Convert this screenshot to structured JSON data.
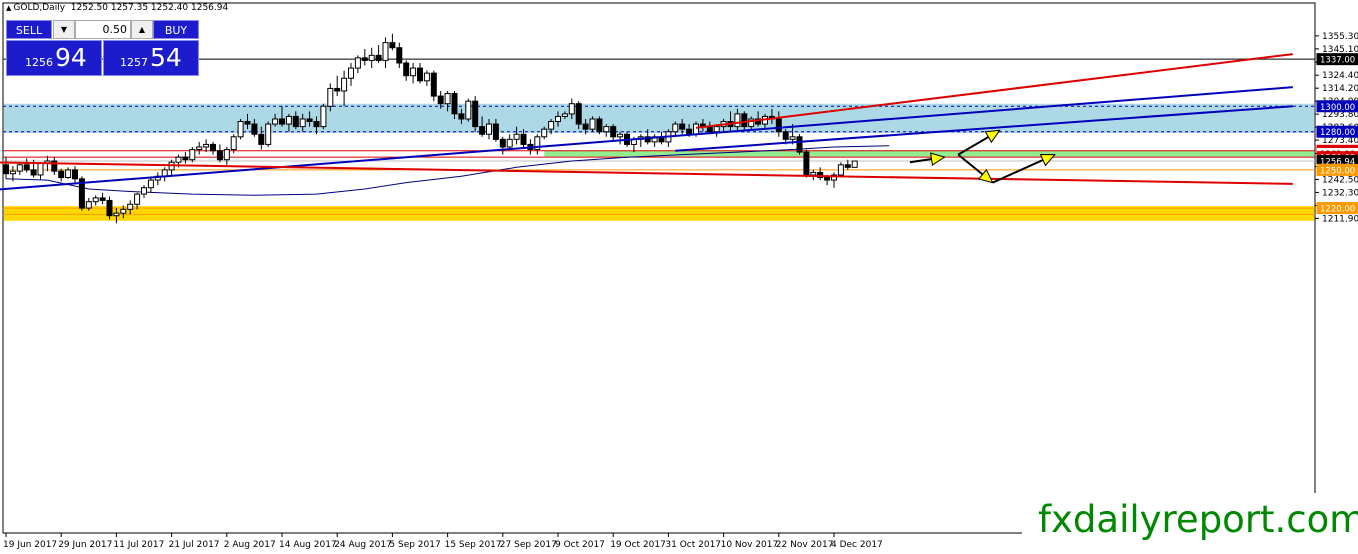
{
  "header": {
    "symbol": "GOLD,Daily",
    "ohlc": "1252.50 1257.35 1252.40 1256.94"
  },
  "trade_panel": {
    "sell_label": "SELL",
    "buy_label": "BUY",
    "lot_value": "0.50",
    "sell_price_small": "1256",
    "sell_price_big": "94",
    "buy_price_small": "1257",
    "buy_price_big": "54"
  },
  "watermark": "fxdailyreport.com",
  "colors": {
    "candle": "#000000",
    "trend_blue": "#0000bb",
    "trend_red": "#dd0000",
    "zone_blue": "#add8e6",
    "zone_green": "#90ee90",
    "zone_yellow": "#ffd700",
    "arrow": "#000000",
    "arrowhead": "#ffff00",
    "moving_average": "#000080",
    "watermark": "#008800"
  },
  "chart_data": {
    "type": "candlestick",
    "title": "GOLD,Daily",
    "ylim": [
      1212.4,
      1361.6
    ],
    "y_ticks": [
      "1355.30",
      "1345.10",
      "1334.60",
      "1324.40",
      "1314.20",
      "1304.00",
      "1293.80",
      "1283.60",
      "1273.40",
      "1262.90",
      "1252.70",
      "1242.50",
      "1232.30",
      "1222.10",
      "1211.90"
    ],
    "x_ticks": [
      "19 Jun 2017",
      "29 Jun 2017",
      "11 Jul 2017",
      "21 Jul 2017",
      "2 Aug 2017",
      "14 Aug 2017",
      "24 Aug 2017",
      "5 Sep 2017",
      "15 Sep 2017",
      "27 Sep 2017",
      "9 Oct 2017",
      "19 Oct 2017",
      "31 Oct 2017",
      "10 Nov 2017",
      "22 Nov 2017",
      "4 Dec 2017"
    ],
    "x_tick_index": [
      0,
      8,
      16,
      24,
      32,
      40,
      48,
      56,
      64,
      72,
      80,
      88,
      96,
      104,
      112,
      120
    ],
    "candles": [
      [
        1254,
        1260,
        1243,
        1247
      ],
      [
        1247,
        1253,
        1241,
        1249
      ],
      [
        1249,
        1256,
        1246,
        1254
      ],
      [
        1254,
        1259,
        1248,
        1250
      ],
      [
        1250,
        1258,
        1244,
        1246
      ],
      [
        1246,
        1256,
        1242,
        1255
      ],
      [
        1255,
        1261,
        1249,
        1257
      ],
      [
        1257,
        1260,
        1246,
        1249
      ],
      [
        1249,
        1251,
        1241,
        1244
      ],
      [
        1244,
        1252,
        1243,
        1250
      ],
      [
        1250,
        1253,
        1240,
        1243
      ],
      [
        1243,
        1245,
        1218,
        1220
      ],
      [
        1220,
        1228,
        1218,
        1225
      ],
      [
        1225,
        1230,
        1222,
        1228
      ],
      [
        1228,
        1232,
        1223,
        1226
      ],
      [
        1226,
        1229,
        1211,
        1214
      ],
      [
        1214,
        1220,
        1208,
        1216
      ],
      [
        1216,
        1222,
        1212,
        1219
      ],
      [
        1219,
        1226,
        1215,
        1223
      ],
      [
        1223,
        1232,
        1219,
        1231
      ],
      [
        1231,
        1238,
        1228,
        1236
      ],
      [
        1236,
        1244,
        1232,
        1242
      ],
      [
        1242,
        1248,
        1238,
        1245
      ],
      [
        1245,
        1252,
        1241,
        1250
      ],
      [
        1250,
        1258,
        1246,
        1256
      ],
      [
        1256,
        1262,
        1252,
        1260
      ],
      [
        1260,
        1264,
        1255,
        1258
      ],
      [
        1258,
        1268,
        1256,
        1266
      ],
      [
        1266,
        1272,
        1262,
        1268
      ],
      [
        1268,
        1274,
        1264,
        1270
      ],
      [
        1270,
        1272,
        1262,
        1265
      ],
      [
        1265,
        1270,
        1256,
        1258
      ],
      [
        1258,
        1268,
        1254,
        1266
      ],
      [
        1266,
        1278,
        1263,
        1276
      ],
      [
        1276,
        1290,
        1274,
        1288
      ],
      [
        1288,
        1294,
        1282,
        1286
      ],
      [
        1286,
        1290,
        1276,
        1278
      ],
      [
        1278,
        1284,
        1266,
        1270
      ],
      [
        1270,
        1288,
        1268,
        1286
      ],
      [
        1286,
        1294,
        1284,
        1290
      ],
      [
        1290,
        1300,
        1284,
        1286
      ],
      [
        1286,
        1294,
        1280,
        1292
      ],
      [
        1292,
        1296,
        1282,
        1284
      ],
      [
        1284,
        1294,
        1280,
        1290
      ],
      [
        1290,
        1296,
        1284,
        1288
      ],
      [
        1288,
        1292,
        1278,
        1284
      ],
      [
        1284,
        1302,
        1282,
        1300
      ],
      [
        1300,
        1318,
        1296,
        1314
      ],
      [
        1314,
        1324,
        1308,
        1312
      ],
      [
        1312,
        1328,
        1300,
        1322
      ],
      [
        1322,
        1334,
        1316,
        1330
      ],
      [
        1330,
        1340,
        1326,
        1338
      ],
      [
        1338,
        1345,
        1332,
        1336
      ],
      [
        1336,
        1346,
        1330,
        1340
      ],
      [
        1340,
        1348,
        1334,
        1336
      ],
      [
        1336,
        1354,
        1330,
        1350
      ],
      [
        1350,
        1357,
        1344,
        1346
      ],
      [
        1346,
        1350,
        1330,
        1334
      ],
      [
        1334,
        1336,
        1320,
        1324
      ],
      [
        1324,
        1334,
        1318,
        1330
      ],
      [
        1330,
        1334,
        1318,
        1320
      ],
      [
        1320,
        1328,
        1316,
        1326
      ],
      [
        1326,
        1328,
        1304,
        1308
      ],
      [
        1308,
        1312,
        1298,
        1302
      ],
      [
        1302,
        1312,
        1296,
        1310
      ],
      [
        1310,
        1312,
        1290,
        1294
      ],
      [
        1294,
        1298,
        1286,
        1290
      ],
      [
        1290,
        1306,
        1288,
        1304
      ],
      [
        1304,
        1308,
        1280,
        1284
      ],
      [
        1284,
        1292,
        1276,
        1278
      ],
      [
        1278,
        1290,
        1274,
        1286
      ],
      [
        1286,
        1290,
        1272,
        1274
      ],
      [
        1274,
        1276,
        1262,
        1268
      ],
      [
        1268,
        1278,
        1266,
        1274
      ],
      [
        1274,
        1284,
        1270,
        1278
      ],
      [
        1278,
        1282,
        1268,
        1270
      ],
      [
        1270,
        1274,
        1262,
        1266
      ],
      [
        1266,
        1278,
        1262,
        1276
      ],
      [
        1276,
        1284,
        1274,
        1282
      ],
      [
        1282,
        1290,
        1278,
        1288
      ],
      [
        1288,
        1296,
        1284,
        1292
      ],
      [
        1292,
        1296,
        1290,
        1294
      ],
      [
        1294,
        1306,
        1290,
        1302
      ],
      [
        1302,
        1304,
        1282,
        1286
      ],
      [
        1286,
        1290,
        1278,
        1282
      ],
      [
        1282,
        1292,
        1280,
        1290
      ],
      [
        1290,
        1292,
        1278,
        1280
      ],
      [
        1280,
        1286,
        1276,
        1284
      ],
      [
        1284,
        1286,
        1272,
        1276
      ],
      [
        1276,
        1280,
        1270,
        1278
      ],
      [
        1278,
        1280,
        1268,
        1270
      ],
      [
        1270,
        1276,
        1264,
        1274
      ],
      [
        1274,
        1278,
        1268,
        1276
      ],
      [
        1276,
        1282,
        1270,
        1272
      ],
      [
        1272,
        1278,
        1268,
        1276
      ],
      [
        1276,
        1280,
        1270,
        1272
      ],
      [
        1272,
        1282,
        1268,
        1280
      ],
      [
        1280,
        1288,
        1276,
        1286
      ],
      [
        1286,
        1290,
        1278,
        1282
      ],
      [
        1282,
        1286,
        1276,
        1278
      ],
      [
        1278,
        1288,
        1276,
        1286
      ],
      [
        1286,
        1290,
        1280,
        1284
      ],
      [
        1284,
        1288,
        1278,
        1280
      ],
      [
        1280,
        1286,
        1276,
        1284
      ],
      [
        1284,
        1290,
        1280,
        1288
      ],
      [
        1288,
        1296,
        1280,
        1284
      ],
      [
        1284,
        1298,
        1280,
        1294
      ],
      [
        1294,
        1296,
        1280,
        1284
      ],
      [
        1284,
        1292,
        1282,
        1290
      ],
      [
        1290,
        1296,
        1284,
        1286
      ],
      [
        1286,
        1294,
        1282,
        1292
      ],
      [
        1292,
        1298,
        1286,
        1290
      ],
      [
        1290,
        1296,
        1276,
        1280
      ],
      [
        1280,
        1282,
        1270,
        1274
      ],
      [
        1274,
        1286,
        1270,
        1276
      ],
      [
        1276,
        1278,
        1262,
        1264
      ],
      [
        1264,
        1266,
        1244,
        1246
      ],
      [
        1246,
        1250,
        1242,
        1248
      ],
      [
        1248,
        1252,
        1242,
        1244
      ],
      [
        1244,
        1246,
        1238,
        1242
      ],
      [
        1242,
        1248,
        1236,
        1246
      ],
      [
        1246,
        1256,
        1244,
        1254
      ],
      [
        1254,
        1258,
        1250,
        1252
      ],
      [
        1252,
        1257.35,
        1252.4,
        1256.94
      ]
    ],
    "moving_average": [
      [
        0,
        1243
      ],
      [
        6,
        1242
      ],
      [
        12,
        1235
      ],
      [
        18,
        1233
      ],
      [
        27,
        1231
      ],
      [
        36,
        1230
      ],
      [
        45,
        1231
      ],
      [
        52,
        1235
      ],
      [
        58,
        1240
      ],
      [
        66,
        1245
      ],
      [
        74,
        1252
      ],
      [
        82,
        1257
      ],
      [
        90,
        1260
      ],
      [
        98,
        1262
      ],
      [
        106,
        1264
      ],
      [
        114,
        1266
      ],
      [
        120,
        1268
      ],
      [
        128,
        1269
      ]
    ],
    "trend_lines": [
      {
        "color": "blue",
        "from": [
          -2.5,
          1234
        ],
        "to": [
          186.5,
          1315
        ]
      },
      {
        "color": "blue",
        "from": [
          97,
          1265
        ],
        "to": [
          186.5,
          1300
        ]
      },
      {
        "color": "red",
        "from": [
          100,
          1283
        ],
        "to": [
          186.5,
          1341
        ]
      },
      {
        "color": "red",
        "from": [
          -2.5,
          1256
        ],
        "to": [
          186.5,
          1239
        ]
      }
    ],
    "zones": [
      {
        "color": "blue",
        "from": 1279,
        "to": 1302
      },
      {
        "color": "green",
        "from": 1260.4,
        "to": 1265.2,
        "x_from": 78
      },
      {
        "color": "yellow",
        "from": 1210,
        "to": 1221.5
      }
    ],
    "horizontal_lines": [
      {
        "value": 1337,
        "color": "black",
        "style": "solid"
      },
      {
        "value": 1300,
        "color": "blue",
        "style": "dashed"
      },
      {
        "value": 1280,
        "color": "blue",
        "style": "dashed"
      },
      {
        "value": 1265,
        "color": "red",
        "style": "solid"
      },
      {
        "value": 1260,
        "color": "red",
        "style": "solid"
      },
      {
        "value": 1256.94,
        "color": "silver",
        "style": "solid"
      },
      {
        "value": 1250,
        "color": "orange",
        "style": "solid"
      },
      {
        "value": 1220,
        "color": "orange",
        "style": "solid"
      },
      {
        "value": 1215,
        "color": "orange",
        "style": "solid"
      }
    ],
    "price_tags": [
      {
        "text": "1337.00",
        "value": 1337,
        "bg": "#000000",
        "fg": "#ffffff"
      },
      {
        "text": "1300.00",
        "value": 1300,
        "bg": "#0000bb",
        "fg": "#ffffff"
      },
      {
        "text": "1280.00",
        "value": 1280,
        "bg": "#0000bb",
        "fg": "#ffffff"
      },
      {
        "text": "1265.00",
        "value": 1265,
        "bg": "#dd0000",
        "fg": "#ffffff"
      },
      {
        "text": "1262.90",
        "value": 1262.9,
        "bg": "#ffffff",
        "fg": "#000000"
      },
      {
        "text": "1260.00",
        "value": 1260,
        "bg": "#dd0000",
        "fg": "#ffffff"
      },
      {
        "text": "1256.94",
        "value": 1256.94,
        "bg": "#000000",
        "fg": "#ffffff"
      },
      {
        "text": "1250.00",
        "value": 1250,
        "bg": "#ff9900",
        "fg": "#ffffff"
      },
      {
        "text": "1220.00",
        "value": 1220,
        "bg": "#ff9900",
        "fg": "#ffffff"
      }
    ],
    "forecast_arrows": [
      {
        "from": [
          131,
          1256
        ],
        "to": [
          136,
          1260
        ]
      },
      {
        "from": [
          138,
          1262
        ],
        "to": [
          143,
          1240
        ]
      },
      {
        "from": [
          143,
          1240
        ],
        "to": [
          152,
          1262
        ]
      },
      {
        "from": [
          138,
          1262
        ],
        "to": [
          144,
          1281
        ]
      }
    ]
  }
}
